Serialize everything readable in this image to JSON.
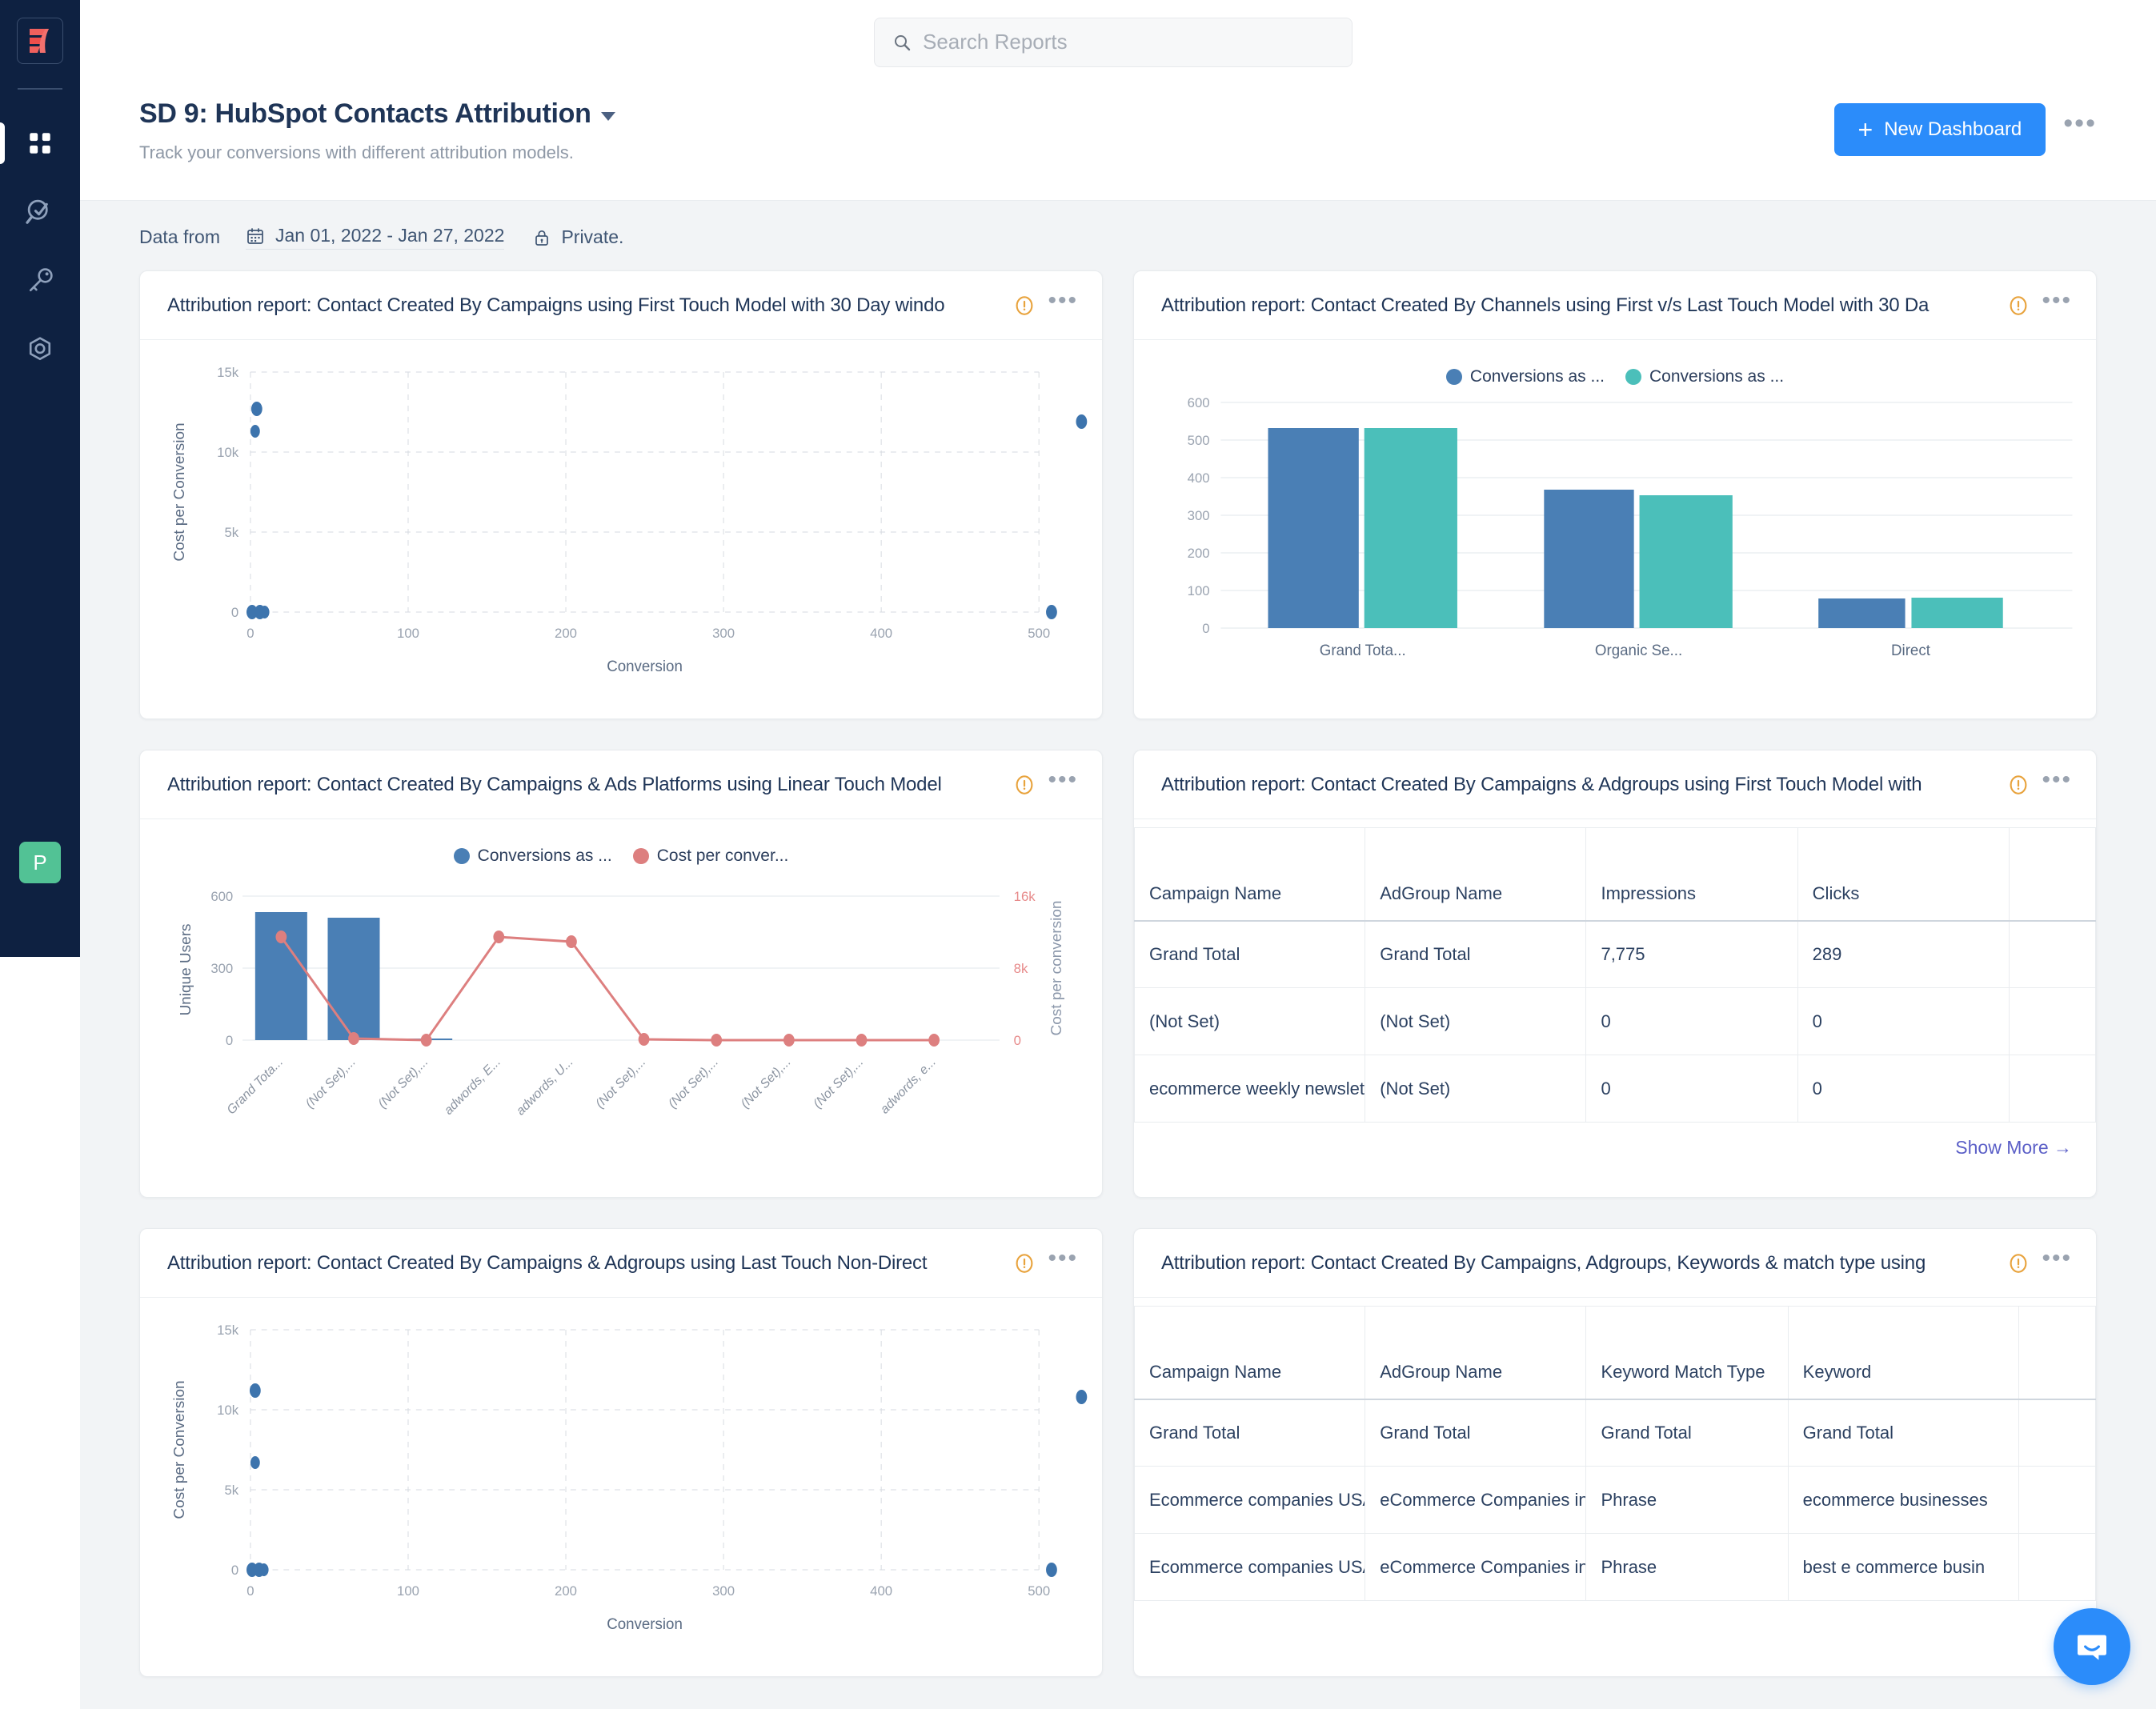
{
  "brand": {
    "accent": "#2b8cfa",
    "sidebar_bg": "#0e2141",
    "avatar_bg": "#52c295",
    "series_blue": "#4a7fb5",
    "series_teal": "#4bbfba",
    "series_red": "#dd7f7f"
  },
  "sidebar": {
    "logo_name": "factors-logo",
    "items": [
      {
        "name": "dashboards",
        "icon": "grid-icon",
        "active": true
      },
      {
        "name": "analytics",
        "icon": "analytics-search-icon",
        "active": false
      },
      {
        "name": "attribution-key",
        "icon": "key-icon",
        "active": false
      },
      {
        "name": "settings",
        "icon": "settings-hex-icon",
        "active": false
      }
    ],
    "avatar_initial": "P"
  },
  "search": {
    "placeholder": "Search Reports",
    "value": "",
    "icon": "search-icon"
  },
  "header": {
    "title": "SD 9: HubSpot Contacts Attribution",
    "subtitle": "Track your conversions with different attribution models.",
    "new_dashboard_label": "New Dashboard",
    "plus": "+",
    "more_label": "•••"
  },
  "metabar": {
    "label": "Data from",
    "date_range": "Jan 01, 2022 - Jan 27, 2022",
    "privacy": "Private.",
    "calendar_icon": "calendar-icon",
    "lock_icon": "lock-icon"
  },
  "cards": [
    {
      "id": "c1",
      "title": "Attribution report: Contact Created By Campaigns using First Touch Model with 30 Day windo"
    },
    {
      "id": "c2",
      "title": "Attribution report: Contact Created By Channels using First v/s Last Touch Model with 30 Da"
    },
    {
      "id": "c3",
      "title": "Attribution report: Contact Created By Campaigns & Ads Platforms using Linear Touch Model"
    },
    {
      "id": "c4",
      "title": "Attribution report: Contact Created By Campaigns & Adgroups using First Touch Model with"
    },
    {
      "id": "c5",
      "title": "Attribution report: Contact Created By Campaigns & Adgroups using Last Touch Non-Direct"
    },
    {
      "id": "c6",
      "title": "Attribution report: Contact Created By Campaigns, Adgroups, Keywords & match type using"
    }
  ],
  "chart_data": [
    {
      "id": "c1",
      "type": "scatter",
      "title": "Attribution report: Contact Created By Campaigns using First Touch Model with 30 Day windo",
      "xlabel": "Conversion",
      "ylabel": "Cost per Conversion",
      "xticks": [
        "0",
        "100",
        "200",
        "300",
        "400",
        "500"
      ],
      "yticks": [
        "0",
        "5k",
        "10k",
        "15k"
      ],
      "xlim": [
        0,
        560
      ],
      "ylim": [
        0,
        15000
      ],
      "grid": true,
      "points": [
        {
          "x": 4,
          "y": 12700
        },
        {
          "x": 3,
          "y": 11300
        },
        {
          "x": 527,
          "y": 12400
        },
        {
          "x": 1,
          "y": 0
        },
        {
          "x": 5,
          "y": 0
        },
        {
          "x": 9,
          "y": 0
        },
        {
          "x": 508,
          "y": 0
        }
      ]
    },
    {
      "id": "c2",
      "type": "bar",
      "title": "Attribution report: Contact Created By Channels using First v/s Last Touch Model with 30 Da",
      "categories": [
        "Grand Tota...",
        "Organic Se...",
        "Direct"
      ],
      "series": [
        {
          "name": "Conversions as ...",
          "color": "#4a7fb5",
          "values": [
            533,
            369,
            79
          ]
        },
        {
          "name": "Conversions as ...",
          "color": "#4bbfba",
          "values": [
            533,
            354,
            82
          ]
        }
      ],
      "yticks": [
        "0",
        "100",
        "200",
        "300",
        "400",
        "500",
        "600"
      ],
      "ylim": [
        0,
        600
      ],
      "grid": true,
      "legend_position": "top"
    },
    {
      "id": "c3",
      "type": "bar+line",
      "title": "Attribution report: Contact Created By Campaigns & Ads Platforms using Linear Touch Model",
      "categories": [
        "Grand Tota...",
        "(Not Set),...",
        "(Not Set),...",
        "adwords, E...",
        "adwords, U...",
        "(Not Set),...",
        "(Not Set),...",
        "(Not Set),...",
        "(Not Set),...",
        "adwords, e..."
      ],
      "ylabel_left": "Unique Users",
      "ylabel_right": "Cost per conversion",
      "yticks_left": [
        "0",
        "300",
        "600"
      ],
      "yticks_right": [
        "0",
        "8k",
        "16k"
      ],
      "ylim_left": [
        0,
        600
      ],
      "ylim_right": [
        0,
        16000
      ],
      "series": [
        {
          "name": "Conversions as ...",
          "type": "bar",
          "color": "#4a7fb5",
          "values": [
            533,
            512,
            6,
            0,
            0,
            0,
            0,
            0,
            0,
            0
          ]
        },
        {
          "name": "Cost per conver...",
          "type": "line",
          "color": "#dd7f7f",
          "values": [
            11500,
            250,
            0,
            12800,
            12500,
            100,
            100,
            100,
            100,
            100
          ]
        }
      ],
      "legend_position": "top"
    },
    {
      "id": "c4",
      "type": "table",
      "title": "Attribution report: Contact Created By Campaigns & Adgroups using First Touch Model with",
      "columns": [
        "Campaign Name",
        "AdGroup Name",
        "Impressions",
        "Clicks"
      ],
      "rows": [
        [
          "Grand Total",
          "Grand Total",
          "7,775",
          "289"
        ],
        [
          "(Not Set)",
          "(Not Set)",
          "0",
          "0"
        ],
        [
          "ecommerce weekly newsletter",
          "(Not Set)",
          "0",
          "0"
        ]
      ],
      "show_more_label": "Show More →"
    },
    {
      "id": "c5",
      "type": "scatter",
      "title": "Attribution report: Contact Created By Campaigns & Adgroups using Last Touch Non-Direct",
      "xlabel": "Conversion",
      "ylabel": "Cost per Conversion",
      "xticks": [
        "0",
        "100",
        "200",
        "300",
        "400",
        "500"
      ],
      "yticks": [
        "0",
        "5k",
        "10k",
        "15k"
      ],
      "xlim": [
        0,
        560
      ],
      "ylim": [
        0,
        15000
      ],
      "grid": true,
      "points": [
        {
          "x": 3,
          "y": 11200
        },
        {
          "x": 3,
          "y": 6700
        },
        {
          "x": 527,
          "y": 10800
        },
        {
          "x": 1,
          "y": 0
        },
        {
          "x": 4,
          "y": 0
        },
        {
          "x": 8,
          "y": 0
        },
        {
          "x": 508,
          "y": 0
        }
      ]
    },
    {
      "id": "c6",
      "type": "table",
      "title": "Attribution report: Contact Created By Campaigns, Adgroups, Keywords & match type using",
      "columns": [
        "Campaign Name",
        "AdGroup Name",
        "Keyword Match Type",
        "Keyword"
      ],
      "rows": [
        [
          "Grand Total",
          "Grand Total",
          "Grand Total",
          "Grand Total"
        ],
        [
          "Ecommerce companies USA - Phrase",
          "eCommerce Companies in USA",
          "Phrase",
          "ecommerce businesses"
        ],
        [
          "Ecommerce companies USA - Phrase",
          "eCommerce Companies in USA",
          "Phrase",
          "best e commerce busin"
        ]
      ]
    }
  ],
  "intercom": {
    "icon": "chat-bubble-icon"
  }
}
